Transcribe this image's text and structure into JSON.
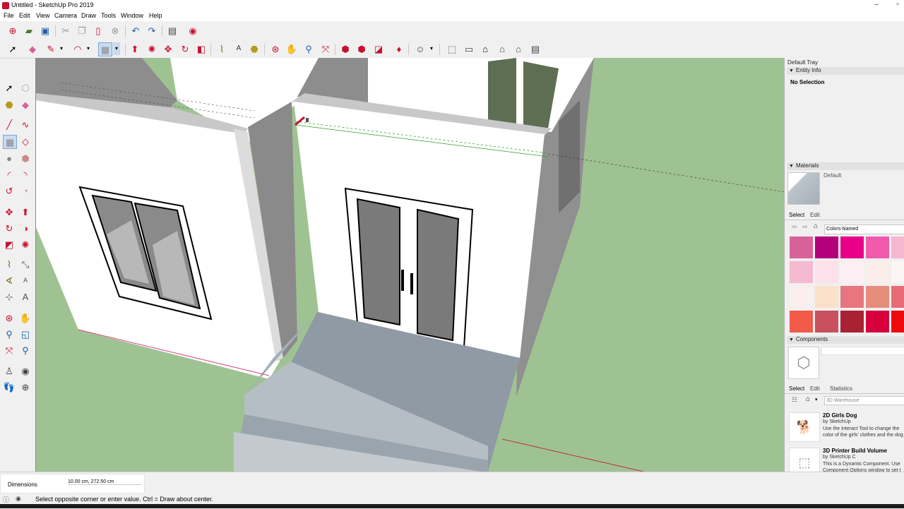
{
  "window": {
    "title": "Untitled - SketchUp Pro 2019",
    "minimize": "–",
    "restore": "▫"
  },
  "menu": [
    "File",
    "Edit",
    "View",
    "Camera",
    "Draw",
    "Tools",
    "Window",
    "Help"
  ],
  "icons": {
    "top_row": [
      "model-info-icon",
      "open-icon",
      "save-icon",
      "cut-icon",
      "copy-icon",
      "paste-icon",
      "erase-icon",
      "undo-icon",
      "redo-icon",
      "print-icon",
      "extension-icon"
    ],
    "second_row": [
      "select-icon",
      "eraser-icon",
      "pencil-icon",
      "chevron-down-icon",
      "arc-icon",
      "chevron-down-icon",
      "rectangle-icon",
      "chevron-down-icon",
      "push-pull-icon",
      "follow-me-icon",
      "move-icon",
      "rotate-icon",
      "offset-icon",
      "tape-measure-icon",
      "text-icon",
      "paint-icon",
      "orbit-icon",
      "pan-icon",
      "zoom-icon",
      "zoom-extents-icon",
      "warehouse-icon",
      "extension-warehouse-icon",
      "layout-icon",
      "ruby-icon",
      "user-icon",
      "chevron-down-icon",
      "iso-view-icon",
      "top-view-icon",
      "front-view-icon",
      "right-view-icon",
      "back-view-icon",
      "left-view-icon"
    ]
  },
  "tray": {
    "title": "Default Tray",
    "entity_info": {
      "header": "Entity Info",
      "selection": "No Selection"
    },
    "materials": {
      "header": "Materials",
      "current": "Default",
      "tabs": [
        "Select",
        "Edit"
      ],
      "library": "Colors-Named",
      "colors": [
        "#d9619a",
        "#b5007b",
        "#e9008a",
        "#f25aad",
        "#f7b6cf",
        "#f5b9d0",
        "#fde1ea",
        "#fdeef4",
        "#fbeeea",
        "#fdf4f6",
        "#fbeeee",
        "#fbe1c8",
        "#e8757f",
        "#e58d7a",
        "#e96b77",
        "#f25a49",
        "#c7505e",
        "#a82233",
        "#d6003f",
        "#ee0a0a"
      ]
    },
    "components": {
      "header": "Components",
      "tabs": [
        "Select",
        "Edit",
        "Statistics"
      ],
      "search": "3D Warehouse",
      "items": [
        {
          "name": "2D Girls Dog",
          "by": "by SketchUp",
          "desc": "Use the Interact Tool to change the color of the girls' clothes and the dog"
        },
        {
          "name": "3D Printer Build Volume",
          "by": "by SketchUp C",
          "desc": "This is a Dynamic Component. Use Component Options window to set t"
        }
      ]
    }
  },
  "status": {
    "measurement_label": "Dimensions",
    "measurement_value": "10.00 cm, 272.50 cm",
    "hint": "Select opposite corner or enter value. Ctrl = Draw about center."
  },
  "accent_color": "#c8102e",
  "sky_color": "#ffffff",
  "ground_color": "#9fc293"
}
